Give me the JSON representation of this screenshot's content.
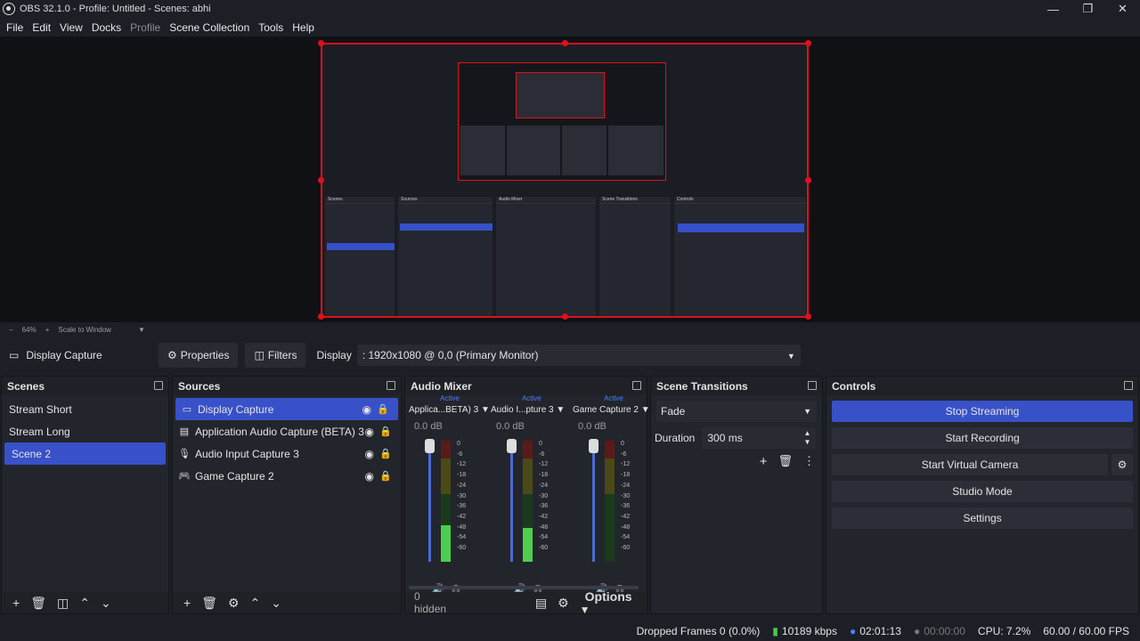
{
  "window": {
    "title": "OBS 32.1.0 - Profile: Untitled - Scenes: abhi"
  },
  "menu": {
    "file": "File",
    "edit": "Edit",
    "view": "View",
    "docks": "Docks",
    "profile": "Profile",
    "scene_collection": "Scene Collection",
    "tools": "Tools",
    "help": "Help"
  },
  "zoom": {
    "level": "64%",
    "mode": "Scale to Window"
  },
  "source_toolbar": {
    "source_name": "Display Capture",
    "properties": "Properties",
    "filters": "Filters",
    "display_label": "Display",
    "display_value": ": 1920x1080 @ 0,0 (Primary Monitor)"
  },
  "scenes": {
    "title": "Scenes",
    "items": [
      "Stream Short",
      "Stream Long",
      "Scene 2"
    ],
    "selected": "Scene 2"
  },
  "sources": {
    "title": "Sources",
    "items": [
      {
        "name": "Display Capture",
        "icon": "monitor-icon"
      },
      {
        "name": "Application Audio Capture (BETA) 3",
        "icon": "app-audio-icon"
      },
      {
        "name": "Audio Input Capture 3",
        "icon": "microphone-icon"
      },
      {
        "name": "Game Capture 2",
        "icon": "gamepad-icon"
      }
    ]
  },
  "mixer": {
    "title": "Audio Mixer",
    "hidden": "0 hidden",
    "options": "Options",
    "channels": [
      {
        "status": "Active",
        "name": "Applica...BETA) 3",
        "db": "0.0 dB",
        "level": 0.3
      },
      {
        "status": "Active",
        "name": "Audio I...pture 3",
        "db": "0.0 dB",
        "level": 0.28
      },
      {
        "status": "Active",
        "name": "Game Capture 2",
        "db": "0.0 dB",
        "level": 0.0
      }
    ],
    "ticks": [
      "0",
      "-6",
      "-12",
      "-18",
      "-24",
      "-30",
      "-36",
      "-42",
      "-48",
      "-54",
      "-60"
    ]
  },
  "transitions": {
    "title": "Scene Transitions",
    "selected": "Fade",
    "duration_label": "Duration",
    "duration_value": "300 ms"
  },
  "controls": {
    "title": "Controls",
    "stop_streaming": "Stop Streaming",
    "start_recording": "Start Recording",
    "start_virtual_camera": "Start Virtual Camera",
    "studio_mode": "Studio Mode",
    "settings": "Settings"
  },
  "status": {
    "dropped": "Dropped Frames 0 (0.0%)",
    "bitrate": "10189 kbps",
    "stream_time": "02:01:13",
    "rec_time": "00:00:00",
    "cpu": "CPU: 7.2%",
    "fps": "60.00 / 60.00 FPS"
  },
  "colors": {
    "accent": "#3851c8",
    "selection": "#e0101a"
  }
}
